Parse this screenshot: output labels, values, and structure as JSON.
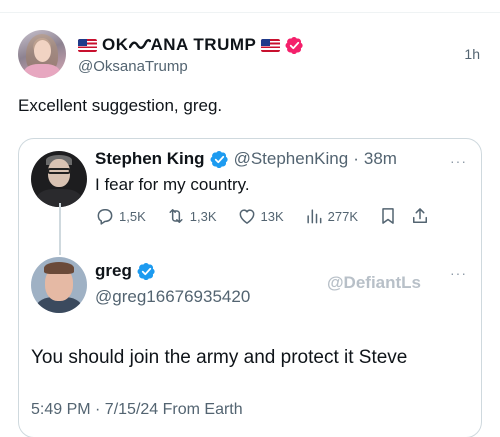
{
  "post": {
    "flag_left": "us-flag-emoji",
    "display_name": "OKᵧᵨANA TRUMP",
    "flag_right": "us-flag-emoji",
    "handle": "@OksanaTrump",
    "time": "1h",
    "text": "Excellent suggestion, greg."
  },
  "quoted_king": {
    "name": "Stephen King",
    "handle": "@StephenKing",
    "separator": "·",
    "time": "38m",
    "text": "I fear for my country.",
    "more": "···",
    "replies": "1,5K",
    "reposts": "1,3K",
    "likes": "13K",
    "views": "277K"
  },
  "quoted_greg": {
    "name": "greg",
    "handle": "@greg16676935420",
    "watermark": "@DefiantLs",
    "more": "···",
    "text": "You should join the army and protect it Steve",
    "meta": "5:49 PM · 7/15/24 From Earth"
  },
  "colors": {
    "verified_blue": "#1d9bf0",
    "verified_pink": "#f4206b",
    "secondary_text": "#536471",
    "border": "#cfd9de"
  }
}
